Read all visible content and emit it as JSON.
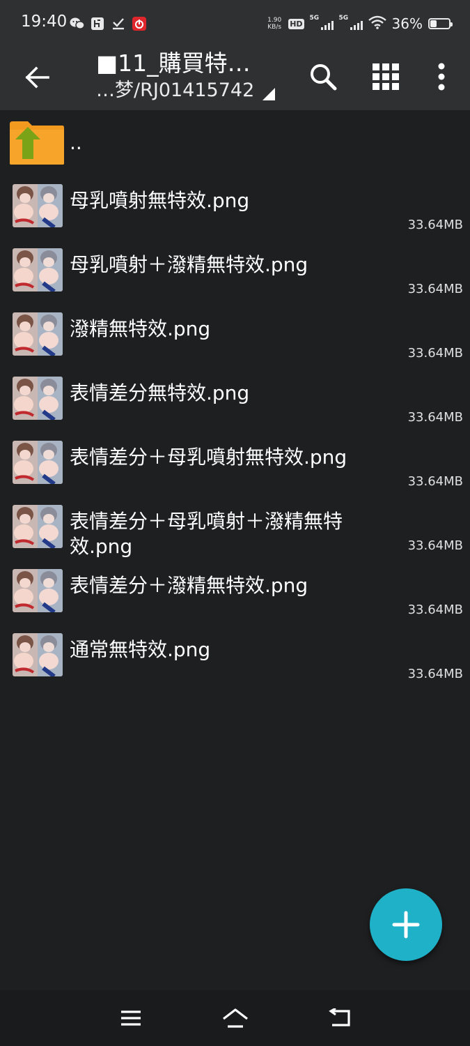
{
  "status_bar": {
    "time": "19:40",
    "net_speed_value": "1.90",
    "net_speed_unit": "KB/s",
    "hd_label": "HD",
    "sim1_label": "5G",
    "sim2_label": "5G",
    "battery_percent": "36%",
    "battery_level": 0.36,
    "app_icons": [
      "wechat-icon",
      "app-icon",
      "download-check-icon",
      "netease-music-icon"
    ]
  },
  "toolbar": {
    "title": "■11_購買特…",
    "subtitle": "…梦/RJ01415742",
    "icons": [
      "back-arrow-icon",
      "search-icon",
      "grid-view-icon",
      "more-vert-icon"
    ]
  },
  "parent_dir": {
    "label": ".."
  },
  "files": [
    {
      "name": "母乳噴射無特效.png",
      "size": "33.64MB"
    },
    {
      "name": "母乳噴射＋潑精無特效.png",
      "size": "33.64MB"
    },
    {
      "name": "潑精無特效.png",
      "size": "33.64MB"
    },
    {
      "name": "表情差分無特效.png",
      "size": "33.64MB"
    },
    {
      "name": "表情差分＋母乳噴射無特效.png",
      "size": "33.64MB"
    },
    {
      "name": "表情差分＋母乳噴射＋潑精無特效.png",
      "size": "33.64MB"
    },
    {
      "name": "表情差分＋潑精無特效.png",
      "size": "33.64MB"
    },
    {
      "name": "通常無特效.png",
      "size": "33.64MB"
    }
  ],
  "fab": {
    "icon": "plus-icon"
  },
  "nav_bar": {
    "icons": [
      "menu-icon",
      "home-icon",
      "back-icon"
    ]
  },
  "colors": {
    "background": "#1e1f21",
    "toolbar": "#2f3032",
    "fab": "#1eb1c8",
    "folder": "#f29a1f",
    "folder_arrow": "#7aa317"
  }
}
